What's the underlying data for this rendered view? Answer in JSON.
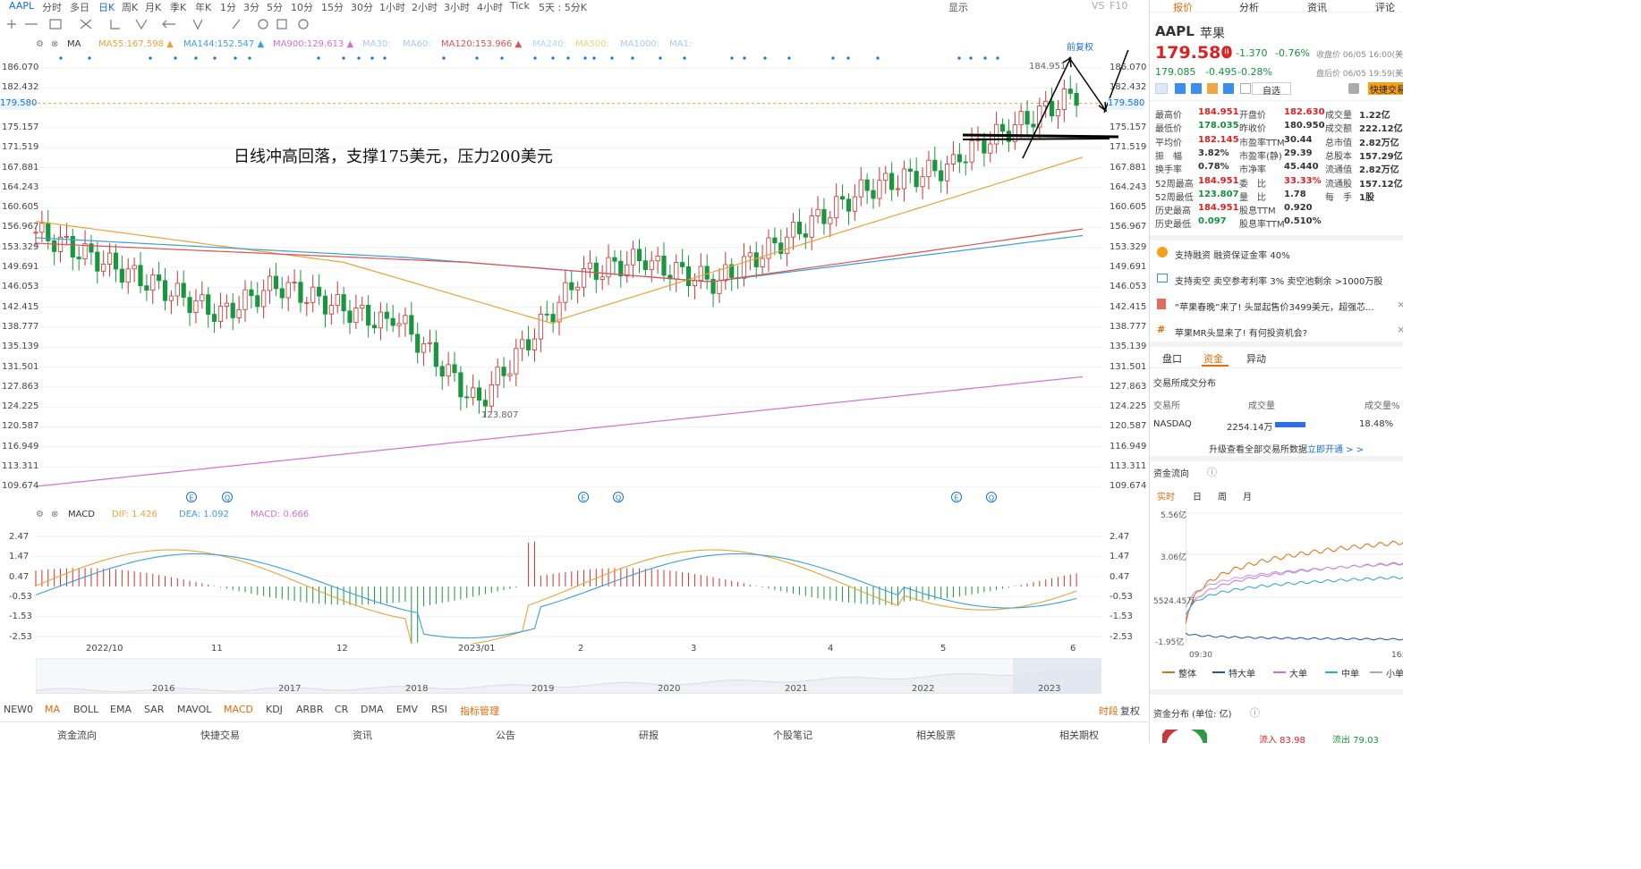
{
  "toolbar": {
    "symbol": "AAPL",
    "periods": [
      "分时",
      "多日",
      "日K",
      "周K",
      "月K",
      "季K",
      "年K",
      "1分",
      "3分",
      "5分",
      "10分",
      "15分",
      "30分",
      "1小时",
      "2小时",
      "3小时",
      "4小时",
      "Tick",
      "5天 : 5分K"
    ],
    "active_period": "日K",
    "display_label": "显示",
    "vs_label": "VS",
    "f10_label": "F10"
  },
  "ma": {
    "label": "MA",
    "items": [
      {
        "name": "MA55:",
        "value": "167.598",
        "color": "#e8a33a"
      },
      {
        "name": "MA144:",
        "value": "152.547",
        "color": "#3aa0d8"
      },
      {
        "name": "MA900:",
        "value": "129.613",
        "color": "#d36fd6"
      },
      {
        "name": "MA30:",
        "value": "",
        "color": "#a9c9ea"
      },
      {
        "name": "MA60:",
        "value": "",
        "color": "#a9c9ea"
      },
      {
        "name": "MA120:",
        "value": "153.966",
        "color": "#e05050"
      },
      {
        "name": "MA240:",
        "value": "",
        "color": "#a9d8f0"
      },
      {
        "name": "MA500:",
        "value": "",
        "color": "#f3cf7a"
      },
      {
        "name": "MA1000:",
        "value": "",
        "color": "#a9c9ea"
      },
      {
        "name": "MA1:",
        "value": "",
        "color": "#a9c9ea"
      }
    ],
    "adjust_label": "前复权"
  },
  "price_axis": [
    "186.070",
    "182.432",
    "179.580",
    "175.157",
    "171.519",
    "167.881",
    "164.243",
    "160.605",
    "156.967",
    "153.329",
    "149.691",
    "146.053",
    "142.415",
    "138.777",
    "135.139",
    "131.501",
    "127.863",
    "124.225",
    "120.587",
    "116.949",
    "113.311",
    "109.674"
  ],
  "current_price_tag": "179.580",
  "high_mark": "184.951",
  "low_mark": "123.807",
  "annotation": "日线冲高回落，支撑175美元，压力200美元",
  "event_markers": [
    "E",
    "Q",
    "E",
    "Q",
    "E",
    "Q"
  ],
  "macd": {
    "label": "MACD",
    "dif": "DIF: 1.426",
    "dea": "DEA: 1.092",
    "macd": "MACD: 0.666",
    "axis": [
      "2.47",
      "1.47",
      "0.47",
      "-0.53",
      "-1.53",
      "-2.53"
    ]
  },
  "x_axis": [
    "2022/10",
    "11",
    "12",
    "2023/01",
    "2",
    "3",
    "4",
    "5",
    "6"
  ],
  "year_axis": [
    "2016",
    "2017",
    "2018",
    "2019",
    "2020",
    "2021",
    "2022",
    "2023"
  ],
  "indicators": [
    "NEW0",
    "MA",
    "BOLL",
    "EMA",
    "SAR",
    "MAVOL",
    "MACD",
    "KDJ",
    "ARBR",
    "CR",
    "DMA",
    "EMV",
    "RSI"
  ],
  "indicator_manage": "指标管理",
  "bottom_right": [
    "时段",
    "复权"
  ],
  "footer_tabs": [
    "资金流向",
    "快捷交易",
    "资讯",
    "公告",
    "研报",
    "个股笔记",
    "相关股票",
    "相关期权"
  ],
  "right": {
    "tabs": [
      "报价",
      "分析",
      "资讯",
      "评论"
    ],
    "ticker": "AAPL",
    "name": "苹果",
    "price": "179.580",
    "arrow": "↓",
    "change": "-1.370",
    "change_pct": "-0.76%",
    "close_time": "收盘价 06/05 16:00(美",
    "after_price": "179.085",
    "after_change": "-0.495",
    "after_pct": "-0.28%",
    "after_time": "盘后价 06/05 19:59(美",
    "watchlist": "自选",
    "quick_trade": "快捷交易",
    "stats": [
      [
        "最高价",
        "184.951",
        "开盘价",
        "182.630",
        "成交量",
        "1.22亿"
      ],
      [
        "最低价",
        "178.035",
        "昨收价",
        "180.950",
        "成交额",
        "222.12亿"
      ],
      [
        "平均价",
        "182.145",
        "市盈率TTM",
        "30.44",
        "总市值",
        "2.82万亿"
      ],
      [
        "振　幅",
        "3.82%",
        "市盈率(静)",
        "29.39",
        "总股本",
        "157.29亿"
      ],
      [
        "换手率",
        "0.78%",
        "市净率",
        "45.440",
        "流通值",
        "2.82万亿"
      ],
      [
        "52周最高",
        "184.951",
        "委　比",
        "33.33%",
        "流通股",
        "157.12亿"
      ],
      [
        "52周最低",
        "123.807",
        "量　比",
        "1.78",
        "每　手",
        "1股"
      ],
      [
        "历史最高",
        "184.951",
        "股息TTM",
        "0.920",
        "",
        ""
      ],
      [
        "历史最低",
        "0.097",
        "股息率TTM",
        "0.510%",
        "",
        ""
      ]
    ],
    "notices": [
      "支持融资  融资保证金率 40%",
      "支持卖空  卖空参考利率 3%  卖空池剩余 >1000万股",
      "“苹果春晚”来了! 头显起售价3499美元，超强芯...",
      "苹果MR头显来了! 有何投资机会?"
    ],
    "subtabs": [
      "盘口",
      "资金",
      "异动"
    ],
    "exchange_title": "交易所成交分布",
    "exchange_headers": [
      "交易所",
      "成交量",
      "成交量%"
    ],
    "exchange_row": [
      "NASDAQ",
      "2254.14万",
      "18.48%"
    ],
    "upgrade_text": "升级查看全部交易所数据",
    "upgrade_link": "立即开通 > >",
    "flow_title": "资金流向",
    "flow_tabs": [
      "实时",
      "日",
      "周",
      "月"
    ],
    "flow_axis": [
      "5.56亿",
      "3.06亿",
      "5524.45万",
      "-1.95亿"
    ],
    "flow_x": [
      "09:30",
      "16:"
    ],
    "flow_legend": [
      "整体",
      "特大单",
      "大单",
      "中单",
      "小单"
    ],
    "dist_title": "资金分布 (单位: 亿)",
    "inflow": "流入 83.98",
    "outflow": "流出 79.03"
  }
}
